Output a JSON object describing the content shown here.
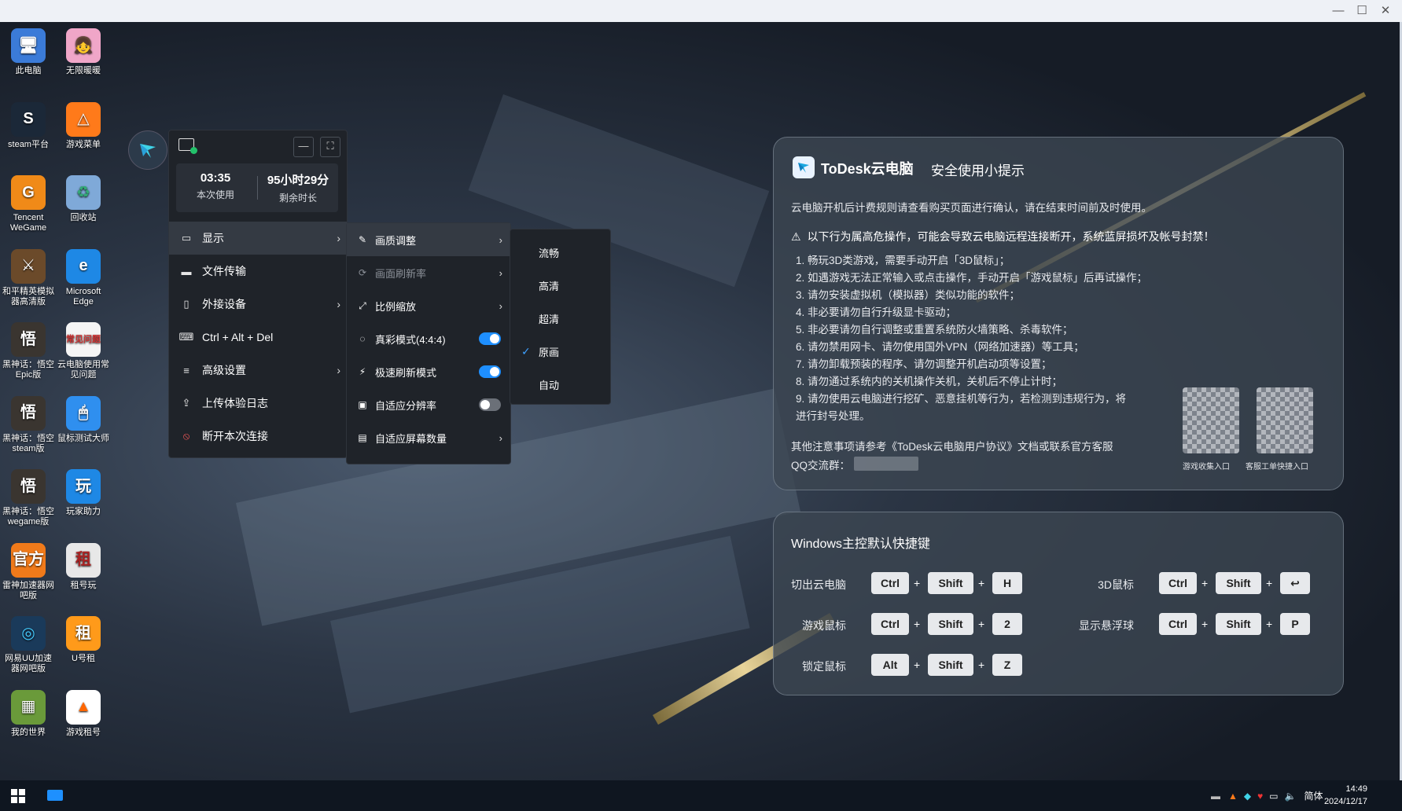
{
  "desktop_icons": [
    {
      "label": "此电脑",
      "glyph": "🖥"
    },
    {
      "label": "无限暖暖",
      "glyph": "👧"
    },
    {
      "label": "steam平台",
      "glyph": "S"
    },
    {
      "label": "游戏菜单",
      "glyph": "△"
    },
    {
      "label": "Tencent WeGame",
      "glyph": "G"
    },
    {
      "label": "回收站",
      "glyph": "♻"
    },
    {
      "label": "和平精英模拟器高清版",
      "glyph": "⚔"
    },
    {
      "label": "Microsoft Edge",
      "glyph": "e"
    },
    {
      "label": "黑神话：悟空 Epic版",
      "glyph": "悟"
    },
    {
      "label": "云电脑使用常见问题",
      "glyph": "常见问题"
    },
    {
      "label": "黑神话：悟空 steam版",
      "glyph": "悟"
    },
    {
      "label": "鼠标测试大师",
      "glyph": "🖱"
    },
    {
      "label": "黑神话：悟空 wegame版",
      "glyph": "悟"
    },
    {
      "label": "玩家助力",
      "glyph": "玩"
    },
    {
      "label": "雷神加速器网吧版",
      "glyph": "官方"
    },
    {
      "label": "租号玩",
      "glyph": "租"
    },
    {
      "label": "网易UU加速器网吧版",
      "glyph": "◎"
    },
    {
      "label": "U号租",
      "glyph": "租"
    },
    {
      "label": "我的世界",
      "glyph": "▦"
    },
    {
      "label": "游戏租号",
      "glyph": "▲"
    }
  ],
  "panel": {
    "session_time": "03:35",
    "session_time_label": "本次使用",
    "remaining_time": "95小时29分",
    "remaining_time_label": "剩余时长",
    "minimize_glyph": "—",
    "fullscreen_glyph": "⛶",
    "menu": [
      {
        "label": "显示",
        "icon": "monitor-icon",
        "glyph": "▭",
        "arrow": "›"
      },
      {
        "label": "文件传输",
        "icon": "folder-icon",
        "glyph": "▬",
        "arrow": ""
      },
      {
        "label": "外接设备",
        "icon": "mouse-icon",
        "glyph": "▯",
        "arrow": "›"
      },
      {
        "label": "Ctrl + Alt + Del",
        "icon": "keyboard-icon",
        "glyph": "⌨",
        "arrow": ""
      },
      {
        "label": "高级设置",
        "icon": "sliders-icon",
        "glyph": "≡",
        "arrow": "›"
      },
      {
        "label": "上传体验日志",
        "icon": "upload-log-icon",
        "glyph": "⇪",
        "arrow": ""
      },
      {
        "label": "断开本次连接",
        "icon": "disconnect-icon",
        "glyph": "⦸",
        "arrow": ""
      }
    ]
  },
  "display_submenu": [
    {
      "label": "画质调整",
      "glyph": "✎",
      "arrow": "›"
    },
    {
      "label": "画面刷新率",
      "glyph": "⟳",
      "arrow": "›"
    },
    {
      "label": "比例缩放",
      "glyph": "⤢",
      "arrow": "›"
    },
    {
      "label": "真彩模式(4:4:4)",
      "glyph": "◌",
      "toggle": "on"
    },
    {
      "label": "极速刷新模式",
      "glyph": "⚡",
      "toggle": "on"
    },
    {
      "label": "自适应分辨率",
      "glyph": "▣",
      "toggle": "off"
    },
    {
      "label": "自适应屏幕数量",
      "glyph": "▤",
      "arrow": "›"
    }
  ],
  "quality_submenu": {
    "options": [
      "流畅",
      "高清",
      "超清",
      "原画",
      "自动"
    ],
    "selected": "原画"
  },
  "tips_card": {
    "brand": "ToDesk云电脑",
    "title": "安全使用小提示",
    "intro": "云电脑开机后计费规则请查看购买页面进行确认，请在结束时间前及时使用。",
    "warning": "以下行为属高危操作，可能会导致云电脑远程连接断开，系统蓝屏损坏及帐号封禁！",
    "rules": [
      "1. 畅玩3D类游戏，需要手动开启「3D鼠标」；",
      "2. 如遇游戏无法正常输入或点击操作，手动开启「游戏鼠标」后再试操作；",
      "3. 请勿安装虚拟机（模拟器）类似功能的软件；",
      "4. 非必要请勿自行升级显卡驱动；",
      "5. 非必要请勿自行调整或重置系统防火墙策略、杀毒软件；",
      "6. 请勿禁用网卡、请勿使用国外VPN（网络加速器）等工具；",
      "7. 请勿卸载预装的程序、请勿调整开机启动项等设置；",
      "8. 请勿通过系统内的关机操作关机，关机后不停止计时；",
      "9. 请勿使用云电脑进行挖矿、恶意挂机等行为，若检测到违规行为，将",
      "    进行封号处理。"
    ],
    "footer": "其他注意事项请参考《ToDesk云电脑用户协议》文档或联系官方客服",
    "qq_label": "QQ交流群：",
    "qr_labels": [
      "游戏收集入口",
      "客服工单快捷入口"
    ]
  },
  "shortcuts_card": {
    "title": "Windows主控默认快捷键",
    "rows": [
      {
        "label": "切出云电脑",
        "keys": [
          "Ctrl",
          "Shift",
          "H"
        ]
      },
      {
        "label": "游戏鼠标",
        "keys": [
          "Ctrl",
          "Shift",
          "2"
        ]
      },
      {
        "label": "锁定鼠标",
        "keys": [
          "Alt",
          "Shift",
          "Z"
        ]
      },
      {
        "label": "3D鼠标",
        "keys": [
          "Ctrl",
          "Shift",
          "↩"
        ]
      },
      {
        "label": "显示悬浮球",
        "keys": [
          "Ctrl",
          "Shift",
          "P"
        ]
      }
    ]
  },
  "taskbar": {
    "lang": "简体",
    "time": "14:49",
    "date": "2024/12/17"
  }
}
